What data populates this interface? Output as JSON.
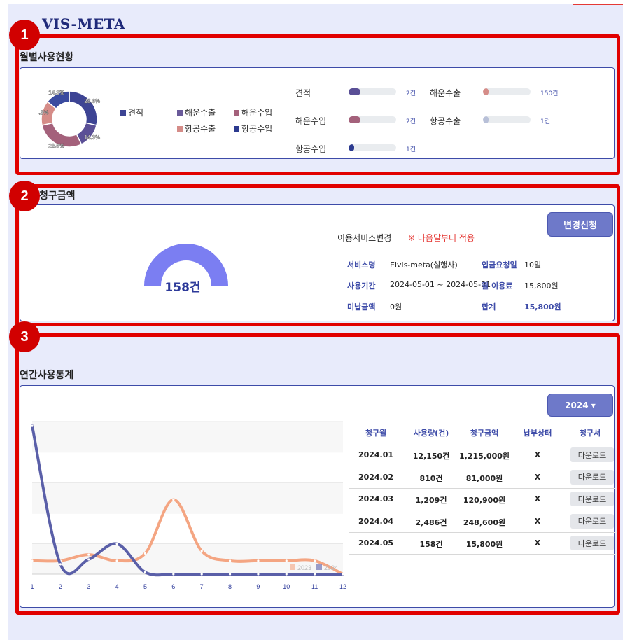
{
  "brand": {
    "logo": "VIS-META"
  },
  "sections": {
    "monthly": {
      "title": "월별사용현황"
    },
    "billing": {
      "title": "청구금액"
    },
    "annual": {
      "title": "연간사용통계"
    }
  },
  "badges": [
    "1",
    "2",
    "3"
  ],
  "donut": {
    "slices": [
      {
        "label": "28.6%",
        "value": 28.6,
        "color": "#3d4494"
      },
      {
        "label": "14.3%",
        "value": 14.3,
        "color": "#5a4f96"
      },
      {
        "label": "28.6%",
        "value": 28.6,
        "color": "#a4617b"
      },
      {
        "label": "14.3%",
        "value": 14.3,
        "color": "#d58c88"
      },
      {
        "label": "14.3%",
        "value": 14.3,
        "color": "#3a4a9f"
      }
    ]
  },
  "legend": [
    {
      "label": "견적",
      "color": "#3d4494"
    },
    {
      "label": "해운수출",
      "color": "#6a5a9a"
    },
    {
      "label": "해운수입",
      "color": "#a4617b"
    },
    {
      "label": "항공수출",
      "color": "#d58c88"
    },
    {
      "label": "항공수입",
      "color": "#2c3a8f"
    }
  ],
  "usage_bars": [
    {
      "label": "견적",
      "count": "2건",
      "fill": 0.25,
      "color": "#5a4f96"
    },
    {
      "label": "해운수출",
      "count": "150건",
      "fill": 0.12,
      "color": "#d58c88"
    },
    {
      "label": "해운수입",
      "count": "2건",
      "fill": 0.25,
      "color": "#a4617b"
    },
    {
      "label": "항공수출",
      "count": "1건",
      "fill": 0.12,
      "color": "#b8c0d8"
    },
    {
      "label": "항공수입",
      "count": "1건",
      "fill": 0.12,
      "color": "#2c3a8f"
    }
  ],
  "billing": {
    "gauge_value": "158건",
    "change_button": "변경신청",
    "service_change_label": "이용서비스변경",
    "service_change_note": "※ 다음달부터 적용",
    "rows": [
      {
        "l1": "서비스명",
        "v1": "Elvis-meta(실행사)",
        "l2": "입금요청일",
        "v2": "10일"
      },
      {
        "l1": "사용기간",
        "v1": "2024-05-01 ~ 2024-05-31",
        "l2": "월 이용료",
        "v2": "15,800원"
      },
      {
        "l1": "미납금액",
        "v1": "0원",
        "l2": "합계",
        "v2": "15,800원"
      }
    ]
  },
  "annual": {
    "year_button": "2024 ▾",
    "columns": [
      "청구월",
      "사용량(건)",
      "청구금액",
      "납부상태",
      "청구서"
    ],
    "rows": [
      {
        "month": "2024.01",
        "usage": "12,150건",
        "amount": "1,215,000원",
        "status": "X",
        "download": "다운로드"
      },
      {
        "month": "2024.02",
        "usage": "810건",
        "amount": "81,000원",
        "status": "X",
        "download": "다운로드"
      },
      {
        "month": "2024.03",
        "usage": "1,209건",
        "amount": "120,900원",
        "status": "X",
        "download": "다운로드"
      },
      {
        "month": "2024.04",
        "usage": "2,486건",
        "amount": "248,600원",
        "status": "X",
        "download": "다운로드"
      },
      {
        "month": "2024.05",
        "usage": "158건",
        "amount": "15,800원",
        "status": "X",
        "download": "다운로드"
      }
    ]
  },
  "chart_data": {
    "type": "line",
    "x": [
      1,
      2,
      3,
      4,
      5,
      6,
      7,
      8,
      9,
      10,
      11,
      12
    ],
    "series": [
      {
        "name": "2023",
        "color": "#f4a582",
        "values": [
          1100,
          1100,
          1600,
          1100,
          1700,
          6100,
          1900,
          1100,
          1100,
          1100,
          1100,
          0
        ]
      },
      {
        "name": "2024",
        "color": "#5a5fa8",
        "values": [
          12150,
          810,
          1209,
          2486,
          158,
          0,
          0,
          0,
          0,
          0,
          0,
          0
        ]
      }
    ],
    "ylim": [
      0,
      12500
    ],
    "grid": true,
    "legend": "bottom-right"
  }
}
